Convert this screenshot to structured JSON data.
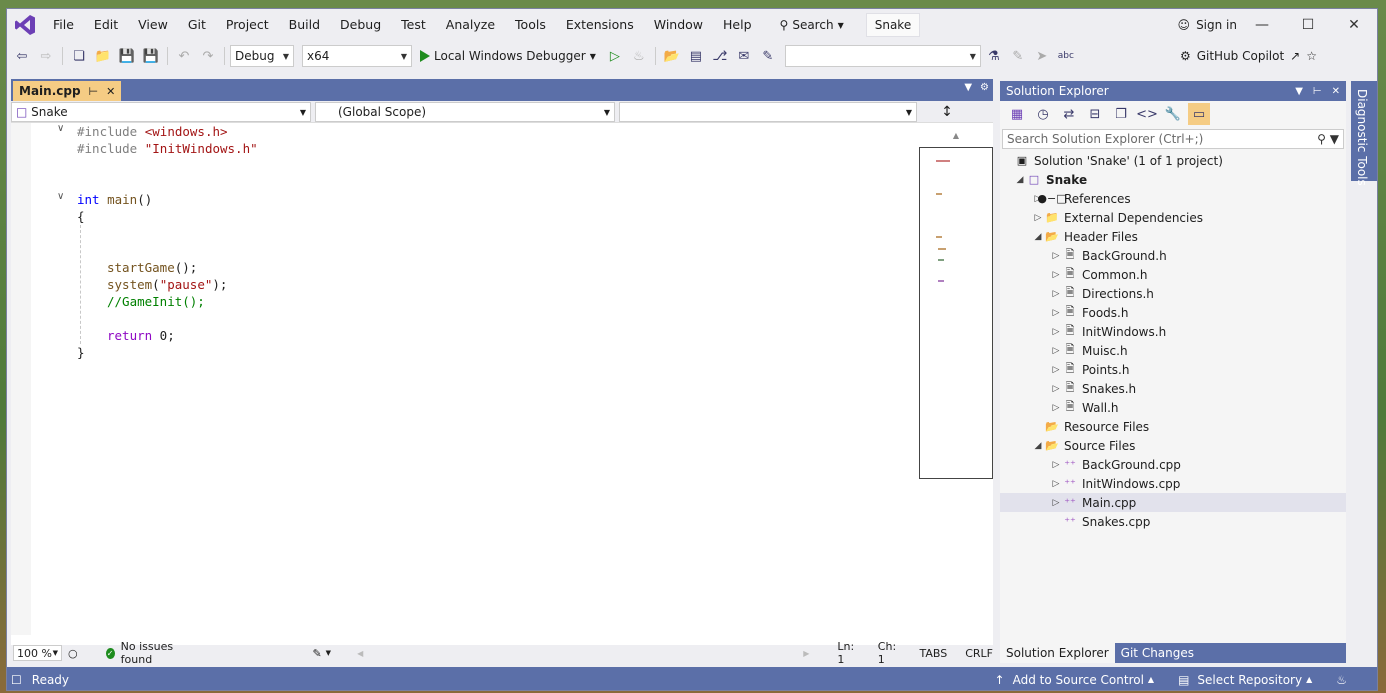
{
  "menu": {
    "items": [
      "File",
      "Edit",
      "View",
      "Git",
      "Project",
      "Build",
      "Debug",
      "Test",
      "Analyze",
      "Tools",
      "Extensions",
      "Window",
      "Help"
    ],
    "search_label": "Search",
    "solution_name": "Snake",
    "sign_in": "Sign in"
  },
  "toolbar": {
    "config": "Debug",
    "platform": "x64",
    "run_label": "Local Windows Debugger",
    "copilot_label": "GitHub Copilot"
  },
  "editor": {
    "tab_title": "Main.cpp",
    "nav_project": "Snake",
    "nav_scope": "(Global Scope)",
    "nav_member": "",
    "code": {
      "line1_pp": "#include",
      "line1_inc": "<windows.h>",
      "line2_pp": "#include",
      "line2_inc": "\"InitWindows.h\"",
      "line5_kw": "int",
      "line5_fn": "main",
      "line5_rest": "()",
      "line6": "{",
      "line9_fn": "startGame",
      "line9_rest": "();",
      "line10_fn": "system",
      "line10_open": "(",
      "line10_str": "\"pause\"",
      "line10_close": ");",
      "line11_cm": "//GameInit();",
      "line13_ret": "return",
      "line13_rest": " 0;",
      "line14": "}"
    },
    "status": {
      "zoom": "100 %",
      "issues": "No issues found",
      "line": "Ln: 1",
      "col": "Ch: 1",
      "tabs": "TABS",
      "eol": "CRLF"
    }
  },
  "solution_explorer": {
    "title": "Solution Explorer",
    "search_placeholder": "Search Solution Explorer (Ctrl+;)",
    "solution_label": "Solution 'Snake' (1 of 1 project)",
    "project": "Snake",
    "references": "References",
    "external_deps": "External Dependencies",
    "header_files": "Header Files",
    "headers": [
      "BackGround.h",
      "Common.h",
      "Directions.h",
      "Foods.h",
      "InitWindows.h",
      "Muisc.h",
      "Points.h",
      "Snakes.h",
      "Wall.h"
    ],
    "resource_files": "Resource Files",
    "source_files": "Source Files",
    "sources": [
      "BackGround.cpp",
      "InitWindows.cpp",
      "Main.cpp",
      "Snakes.cpp"
    ],
    "tab_solution": "Solution Explorer",
    "tab_git": "Git Changes"
  },
  "diagnostic_tools": "Diagnostic Tools",
  "status_bar": {
    "ready": "Ready",
    "source_control": "Add to Source Control",
    "repository": "Select Repository"
  }
}
